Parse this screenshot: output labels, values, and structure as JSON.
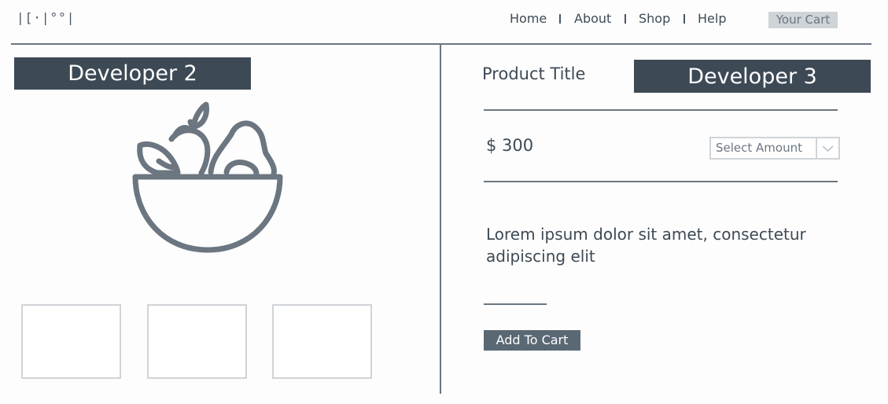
{
  "header": {
    "logo": "|[·|°°|",
    "nav": [
      "Home",
      "About",
      "Shop",
      "Help"
    ],
    "cart_label": "Your Cart"
  },
  "left": {
    "banner": "Developer 2",
    "image_icon": "fruit-bowl-icon",
    "thumbnails_count": 3
  },
  "right": {
    "banner": "Developer 3",
    "product_title": "Product Title",
    "price": "$ 300",
    "select_placeholder": "Select Amount",
    "description": "Lorem ipsum dolor sit amet, consectetur adipiscing elit",
    "add_to_cart": "Add To Cart"
  },
  "colors": {
    "dark": "#3d4a55",
    "muted": "#6b7680",
    "light": "#cfd4d8"
  }
}
